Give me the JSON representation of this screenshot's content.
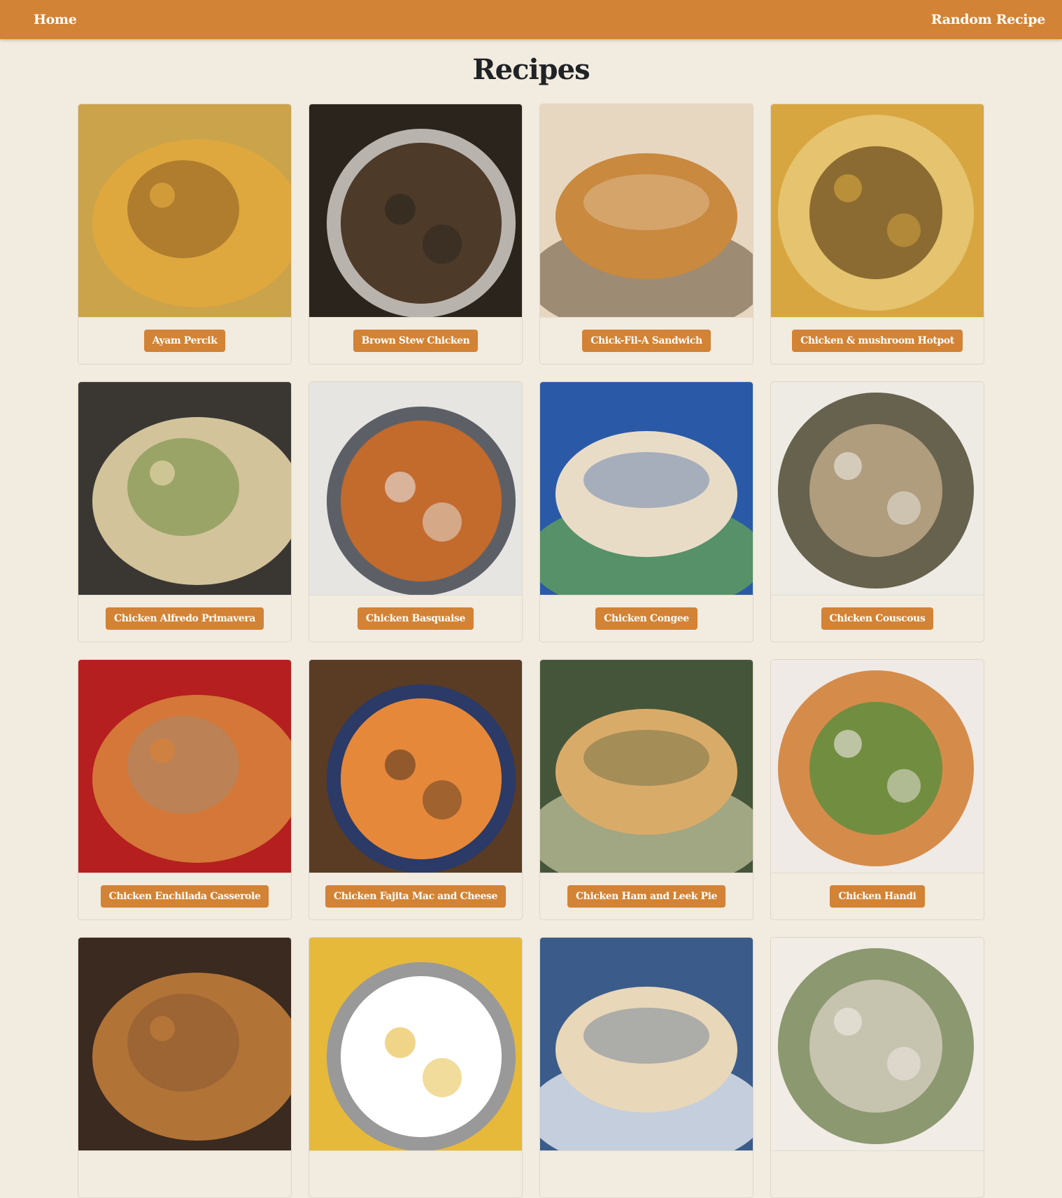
{
  "nav": {
    "home_label": "Home",
    "random_label": "Random Recipe",
    "brand_color": "#d28335"
  },
  "page": {
    "title": "Recipes"
  },
  "recipes": [
    {
      "name": "Ayam Percik",
      "palette": [
        "#caa34b",
        "#e0a83d",
        "#8a5a22"
      ]
    },
    {
      "name": "Brown Stew Chicken",
      "palette": [
        "#2b241d",
        "#4d3a28",
        "#b9b3ad"
      ]
    },
    {
      "name": "Chick-Fil-A Sandwich",
      "palette": [
        "#e7d7c1",
        "#c9893e",
        "#7f6b52"
      ]
    },
    {
      "name": "Chicken & mushroom Hotpot",
      "palette": [
        "#d8a640",
        "#e8c878",
        "#6d4d1d"
      ]
    },
    {
      "name": "Chicken Alfredo Primavera",
      "palette": [
        "#3a3733",
        "#e3d3a6",
        "#6b8b3a"
      ]
    },
    {
      "name": "Chicken Basquaise",
      "palette": [
        "#e7e5e2",
        "#c36a2d",
        "#5c6066"
      ]
    },
    {
      "name": "Chicken Congee",
      "palette": [
        "#2a5aa7",
        "#e9dcc7",
        "#6aa84f"
      ]
    },
    {
      "name": "Chicken Couscous",
      "palette": [
        "#eeeae4",
        "#4f4a33",
        "#c7b28f"
      ]
    },
    {
      "name": "Chicken Enchilada Casserole",
      "palette": [
        "#b51f1f",
        "#d7813b",
        "#a78b6d"
      ]
    },
    {
      "name": "Chicken Fajita Mac and Cheese",
      "palette": [
        "#5a3b24",
        "#e6883a",
        "#2b3a66"
      ]
    },
    {
      "name": "Chicken Ham and Leek Pie",
      "palette": [
        "#45553a",
        "#d9ab69",
        "#c9c9a3"
      ]
    },
    {
      "name": "Chicken Handi",
      "palette": [
        "#efeae6",
        "#d07b2e",
        "#4f8d3d"
      ]
    },
    {
      "name": "",
      "palette": [
        "#3a2a20",
        "#c07b3a",
        "#8a5a32"
      ]
    },
    {
      "name": "",
      "palette": [
        "#e6b93a",
        "#ffffff",
        "#999999"
      ]
    },
    {
      "name": "",
      "palette": [
        "#3b5c8a",
        "#e8d7b8",
        "#ffffff"
      ]
    },
    {
      "name": "",
      "palette": [
        "#f1ece6",
        "#7a8a5a",
        "#d9d2c4"
      ]
    }
  ]
}
